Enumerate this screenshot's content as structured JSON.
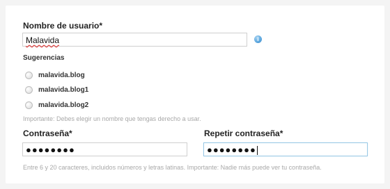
{
  "username": {
    "label": "Nombre de usuario*",
    "value": "Malavida",
    "info_icon": "info-icon"
  },
  "suggestions": {
    "title": "Sugerencias",
    "options": [
      "malavida.blog",
      "malavida.blog1",
      "malavida.blog2"
    ]
  },
  "username_hint": "Importante: Debes elegir un nombre que tengas derecho a usar.",
  "password": {
    "label": "Contraseña*",
    "value": "●●●●●●●●"
  },
  "repeat_password": {
    "label": "Repetir contraseña*",
    "value": "●●●●●●●●"
  },
  "password_hint": "Entre 6 y 20 caracteres, incluidos números y letras latinas. Importante: Nadie más puede ver tu contraseña.",
  "colors": {
    "focus_border": "#9bc9e6",
    "hint_text": "#a8a8a8",
    "info_icon": "#5aa6de"
  }
}
